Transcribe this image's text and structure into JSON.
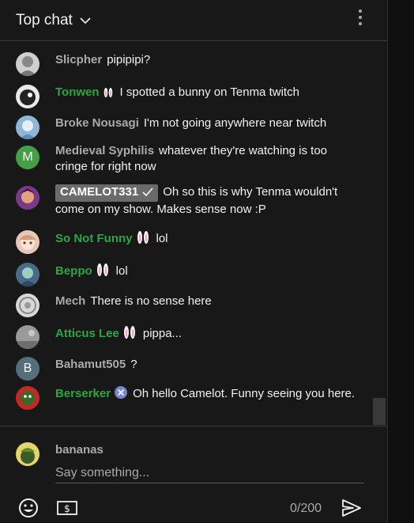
{
  "header": {
    "title": "Top chat"
  },
  "messages": [
    {
      "author": "Slicpher",
      "text": "pipipipi?",
      "avatar_color": "#cfcfcf"
    },
    {
      "author": "Tonwen",
      "text": "I spotted a bunny on Tenma twitch",
      "avatar_color": "#e9e9e9"
    },
    {
      "author": "Broke Nousagi",
      "text": "I'm not going anywhere near twitch",
      "avatar_color": "#8fb6d8"
    },
    {
      "author": "Medieval Syphilis",
      "text": "whatever they're watching is too cringe for right now",
      "avatar_letter": "M",
      "avatar_color": "#43a047"
    },
    {
      "author": "CAMELOT331",
      "text": "Oh so this is why Tenma wouldn't come on my show. Makes sense now :P",
      "avatar_color": "#7a3a8a"
    },
    {
      "author": "So Not Funny",
      "text": "lol",
      "avatar_color": "#e8c6b8"
    },
    {
      "author": "Beppo",
      "text": "lol",
      "avatar_color": "#4a6a8a"
    },
    {
      "author": "Mech",
      "text": "There is no sense here",
      "avatar_color": "#d8d8d8"
    },
    {
      "author": "Atticus Lee",
      "text": "pippa...",
      "avatar_color": "#9a9a9a"
    },
    {
      "author": "Bahamut505",
      "text": "?",
      "avatar_letter": "B",
      "avatar_color": "#546e7a"
    },
    {
      "author": "Berserker",
      "text": "Oh hello Camelot. Funny seeing you here.",
      "avatar_color": "#c62828"
    }
  ],
  "composer": {
    "username": "bananas",
    "placeholder": "Say something...",
    "counter": "0/200"
  },
  "colors": {
    "background": "#181818",
    "member_name": "#2ba640",
    "moderator_chip": "#6b6b6b",
    "default_name": "#aaaaaa"
  },
  "icons": {
    "header_dropdown": "chevron-down-icon",
    "menu": "more-vert-icon",
    "emoji": "emoji-icon",
    "super_chat": "super-chat-dollar-icon",
    "send": "send-icon",
    "member_badge": "bunny-ears-icon",
    "verified": "checkmark-icon",
    "berserker_badge": "x-circle-badge-icon"
  }
}
